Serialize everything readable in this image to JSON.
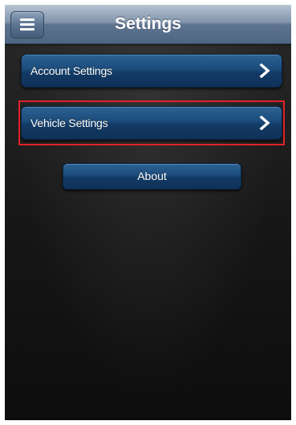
{
  "navbar": {
    "title": "Settings",
    "menu_icon": "hamburger-menu-icon"
  },
  "settings_list": [
    {
      "label": "Account Settings",
      "icon": "chevron-right-icon"
    },
    {
      "label": "Vehicle Settings",
      "icon": "chevron-right-icon",
      "highlighted": true
    }
  ],
  "about_button": {
    "label": "About"
  },
  "colors": {
    "navbar": "#5d738f",
    "button": "#1b4c7c",
    "highlight": "#e0222a",
    "background": "#151515"
  }
}
